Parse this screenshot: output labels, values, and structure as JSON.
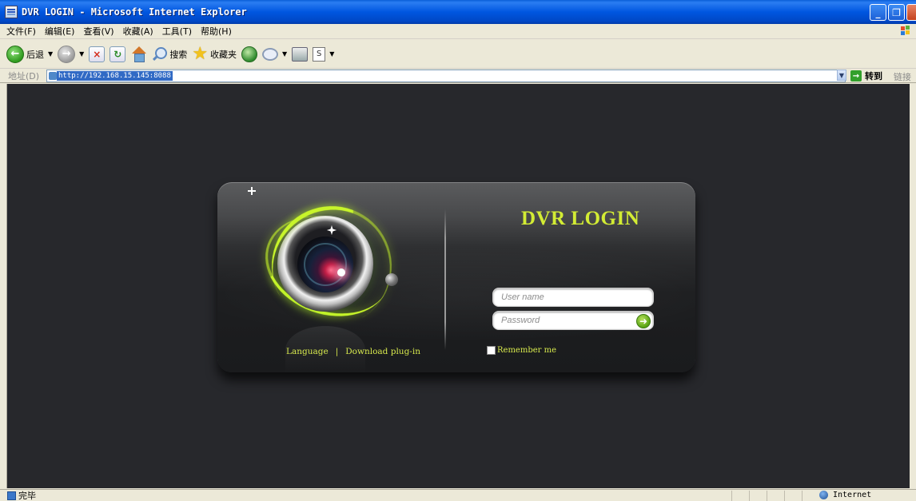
{
  "window": {
    "title": "DVR LOGIN - Microsoft Internet Explorer",
    "buttons": [
      "_",
      "❐",
      "×"
    ]
  },
  "menu": {
    "items": [
      "文件(F)",
      "编辑(E)",
      "查看(V)",
      "收藏(A)",
      "工具(T)",
      "帮助(H)"
    ]
  },
  "toolbar": {
    "back_label": "后退",
    "search_label": "搜索",
    "favorites_label": "收藏夹"
  },
  "address": {
    "label": "地址(D)",
    "url": "http://192.168.15.145:8088",
    "go_label": "转到",
    "links_label": "链接"
  },
  "login": {
    "title": "DVR LOGIN",
    "username_placeholder": "User name",
    "password_placeholder": "Password",
    "remember_label": "Remember me",
    "language_link": "Language",
    "separator": "|",
    "download_link": "Download plug-in"
  },
  "status": {
    "text": "完毕",
    "zone": "Internet"
  },
  "colors": {
    "accent": "#d3ec34",
    "link": "#d7e94d",
    "page_background": "#27282c"
  },
  "icons": {
    "back": "back-arrow-icon",
    "forward": "forward-arrow-icon",
    "stop": "stop-icon",
    "refresh": "refresh-icon",
    "home": "home-icon",
    "search": "search-icon",
    "favorites": "star-icon",
    "media": "media-icon",
    "mail": "mail-icon",
    "print": "print-icon",
    "edit": "edit-icon",
    "go": "go-arrow-icon",
    "submit": "submit-arrow-icon"
  }
}
